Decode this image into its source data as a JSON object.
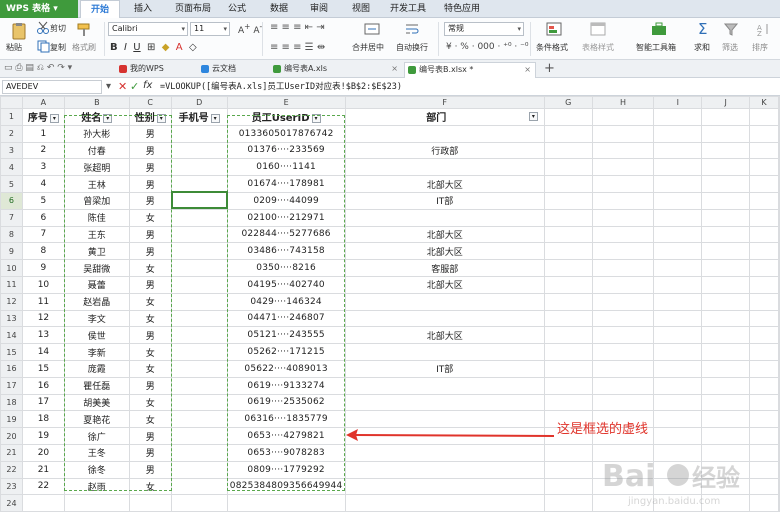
{
  "app": {
    "title": "WPS 表格"
  },
  "menu": {
    "tabs": [
      "开始",
      "插入",
      "页面布局",
      "公式",
      "数据",
      "审阅",
      "视图",
      "开发工具",
      "特色应用"
    ],
    "active": "开始"
  },
  "ribbon": {
    "paste": "粘贴",
    "cut": "剪切",
    "copy": "复制",
    "format_painter": "格式刷",
    "font_name": "Calibri",
    "font_size": "11",
    "merge_center": "合并居中",
    "wrap_text": "自动换行",
    "number_format": "常规",
    "conditional_format": "条件格式",
    "table_style": "表格样式",
    "smart_tools": "智能工具箱",
    "sum": "求和",
    "filter": "筛选",
    "sort": "排序"
  },
  "doc_tabs": {
    "items": [
      {
        "label": "我的WPS",
        "color": "#d6322f"
      },
      {
        "label": "云文档",
        "color": "#2e86de"
      },
      {
        "label": "编号表A.xls",
        "color": "#3f9a3c"
      },
      {
        "label": "编号表B.xlsx *",
        "color": "#3f9a3c"
      }
    ],
    "active_index": 3
  },
  "formula_bar": {
    "name_box": "AVEDEV",
    "formula": "=VLOOKUP([编号表A.xls]员工UserID对应表!$B$2:$E$23)",
    "fx_label": "fx"
  },
  "grid": {
    "columns": [
      "A",
      "B",
      "C",
      "D",
      "E",
      "F",
      "G",
      "H",
      "I",
      "J",
      "K"
    ],
    "headers": [
      "序号",
      "姓名",
      "性别",
      "手机号",
      "员工UserID",
      "部门"
    ],
    "active_row": 6,
    "rows": [
      [
        "1",
        "孙大彬",
        "男",
        "",
        "0133605017876742",
        ""
      ],
      [
        "2",
        "付春",
        "男",
        "",
        "01376····233569",
        "行政部"
      ],
      [
        "3",
        "张超明",
        "男",
        "",
        "0160····1141",
        ""
      ],
      [
        "4",
        "王林",
        "男",
        "",
        "01674····178981",
        "北部大区"
      ],
      [
        "5",
        "曾梁加",
        "男",
        "",
        "0209····44099",
        "IT部"
      ],
      [
        "6",
        "陈佳",
        "女",
        "",
        "02100····212971",
        ""
      ],
      [
        "7",
        "王东",
        "男",
        "",
        "022844····5277686",
        "北部大区"
      ],
      [
        "8",
        "黄卫",
        "男",
        "",
        "03486····743158",
        "北部大区"
      ],
      [
        "9",
        "吴甜微",
        "女",
        "",
        "0350····8216",
        "客服部"
      ],
      [
        "10",
        "聂蕾",
        "男",
        "",
        "04195····402740",
        "北部大区"
      ],
      [
        "11",
        "赵岩晶",
        "女",
        "",
        "0429····146324",
        ""
      ],
      [
        "12",
        "李文",
        "女",
        "",
        "04471····246807",
        ""
      ],
      [
        "13",
        "侯世",
        "男",
        "",
        "05121····243555",
        "北部大区"
      ],
      [
        "14",
        "李新",
        "女",
        "",
        "05262····171215",
        ""
      ],
      [
        "15",
        "庞霞",
        "女",
        "",
        "05622····4089013",
        "IT部"
      ],
      [
        "16",
        "瞿任磊",
        "男",
        "",
        "0619····9133274",
        ""
      ],
      [
        "17",
        "胡美美",
        "女",
        "",
        "0619····2535062",
        ""
      ],
      [
        "18",
        "夏艳花",
        "女",
        "",
        "06316····1835779",
        ""
      ],
      [
        "19",
        "徐广",
        "男",
        "",
        "0653····4279821",
        ""
      ],
      [
        "20",
        "王冬",
        "男",
        "",
        "0653····9078283",
        ""
      ],
      [
        "21",
        "徐冬",
        "男",
        "",
        "0809····1779292",
        ""
      ],
      [
        "22",
        "赵雨",
        "女",
        "",
        "0825384809356649944",
        ""
      ]
    ],
    "row_numbers": [
      "1",
      "2",
      "3",
      "4",
      "5",
      "6",
      "7",
      "8",
      "9",
      "10",
      "11",
      "12",
      "13",
      "14",
      "15",
      "16",
      "17",
      "18",
      "19",
      "20",
      "21",
      "22",
      "23",
      "24"
    ]
  },
  "annotation": {
    "text": "这是框选的虚线",
    "color": "#e0342b"
  },
  "watermark": {
    "text": "Baidu经验",
    "sub": "jingyan.baidu.com"
  }
}
